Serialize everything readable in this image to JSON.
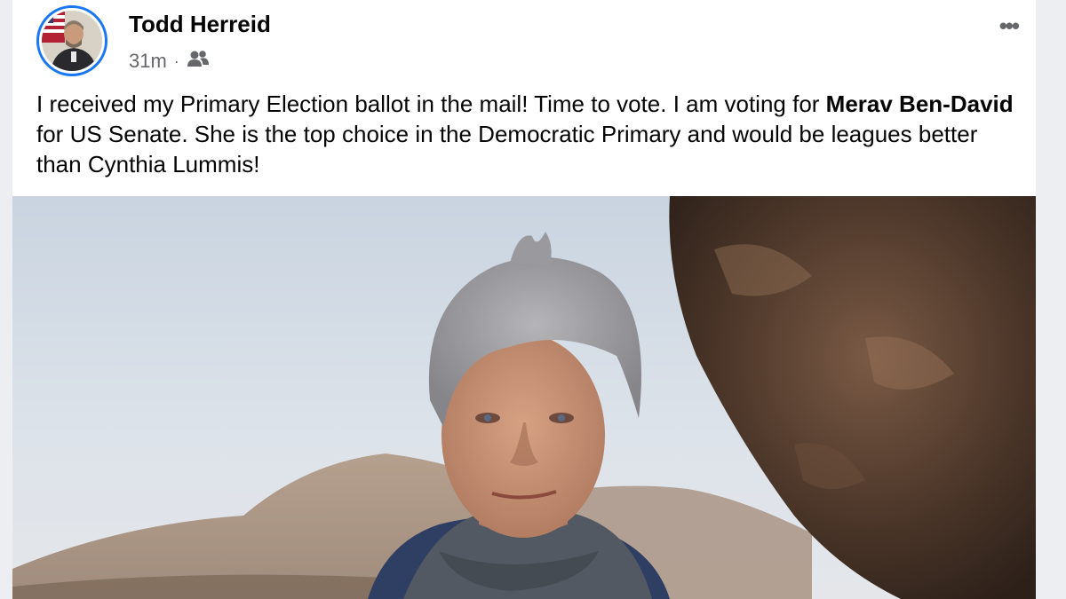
{
  "post": {
    "author_name": "Todd Herreid",
    "timestamp": "31m",
    "separator": "·",
    "audience_icon": "friends-icon",
    "more_icon": "more-options-icon",
    "more_glyph": "•••",
    "text_part1": "I received  my Primary Election ballot in the mail!  Time to vote.  I am voting for ",
    "text_bold": "Merav Ben-David",
    "text_part2": " for US Senate.  She is the top choice in the Democratic Primary and would be leagues better than Cynthia Lummis!"
  },
  "colors": {
    "avatar_ring": "#1877f2",
    "name_text": "#050505",
    "meta_text": "#65676b",
    "page_bg": "#eceef1"
  }
}
